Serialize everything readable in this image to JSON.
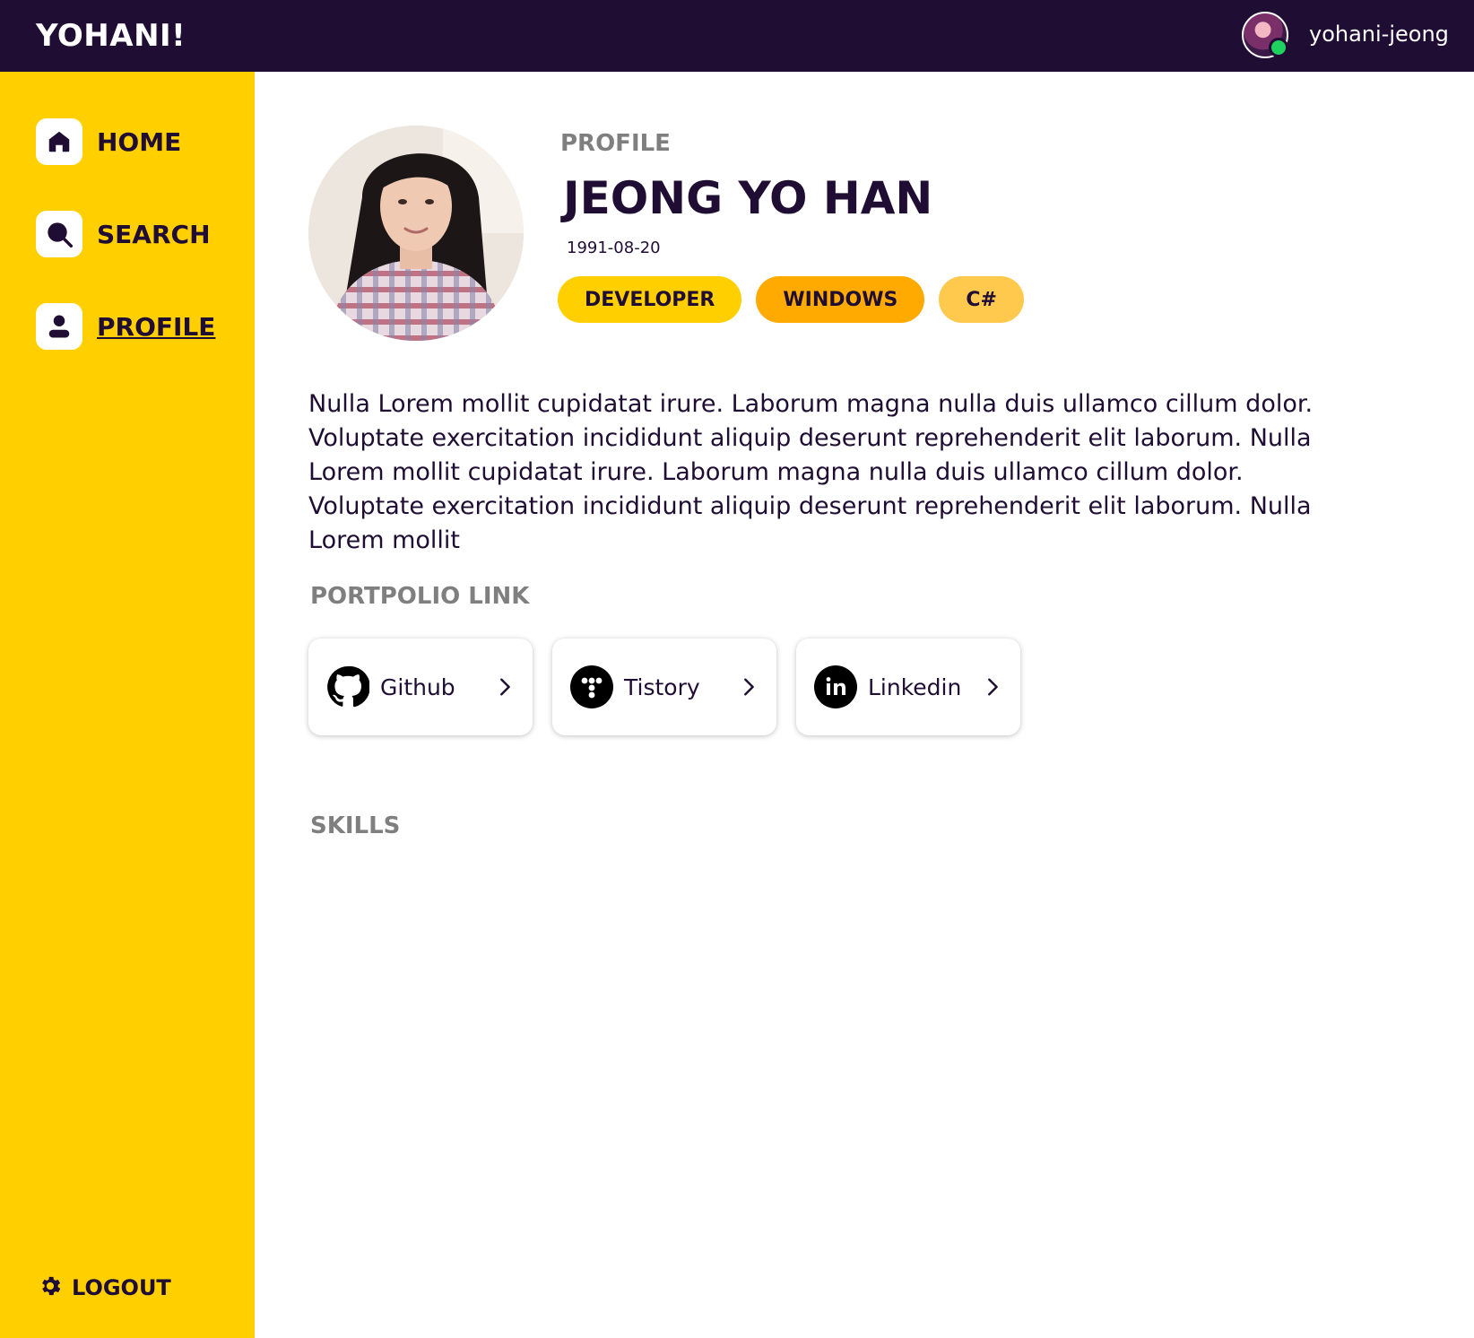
{
  "app": {
    "brand": "YOHANI!"
  },
  "user": {
    "username": "yohani-jeong",
    "status": "online"
  },
  "sidebar": {
    "items": [
      {
        "label": "HOME",
        "icon": "home-icon"
      },
      {
        "label": "SEARCH",
        "icon": "search-icon"
      },
      {
        "label": "PROFILE",
        "icon": "person-icon",
        "active": true
      }
    ],
    "logout": {
      "label": "LOGOUT",
      "icon": "gear-icon"
    }
  },
  "profile": {
    "section_label": "PROFILE",
    "name": "JEONG YO HAN",
    "birthdate": "1991-08-20",
    "tags": [
      "DEVELOPER",
      "WINDOWS",
      "C#"
    ],
    "bio": "Nulla Lorem mollit cupidatat irure. Laborum magna nulla duis ullamco cillum dolor. Voluptate exercitation incididunt aliquip deserunt reprehenderit elit laborum. Nulla Lorem mollit cupidatat irure. Laborum magna nulla duis ullamco cillum dolor. Voluptate exercitation incididunt aliquip deserunt reprehenderit elit laborum. Nulla Lorem mollit"
  },
  "portfolio": {
    "title": "PORTPOLIO LINK",
    "links": [
      {
        "label": "Github",
        "icon": "github-icon"
      },
      {
        "label": "Tistory",
        "icon": "tistory-icon"
      },
      {
        "label": "Linkedin",
        "icon": "linkedin-icon"
      }
    ]
  },
  "skills": {
    "title": "SKILLS"
  },
  "colors": {
    "topbar": "#1f0d33",
    "sidebar": "#ffcf00",
    "text_primary": "#1f0d33",
    "text_muted": "#7f7f7f",
    "tag_developer": "#ffcf00",
    "tag_windows": "#ffaa00",
    "tag_csharp": "#ffc94d",
    "online": "#1fd15e"
  }
}
